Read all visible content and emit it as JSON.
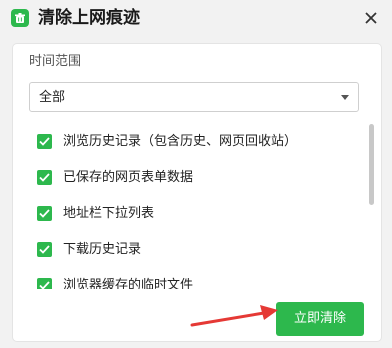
{
  "dialog": {
    "title": "清除上网痕迹",
    "icon": "app-clean-icon",
    "close_icon": "close-icon"
  },
  "time_range": {
    "label": "时间范围",
    "selected": "全部"
  },
  "options": [
    {
      "label": "浏览历史记录（包含历史、网页回收站）",
      "checked": true
    },
    {
      "label": "已保存的网页表单数据",
      "checked": true
    },
    {
      "label": "地址栏下拉列表",
      "checked": true
    },
    {
      "label": "下载历史记录",
      "checked": true
    },
    {
      "label": "浏览器缓存的临时文件",
      "checked": true
    }
  ],
  "actions": {
    "clear_label": "立即清除"
  },
  "colors": {
    "accent": "#2db84d",
    "annotation_arrow": "#e53935"
  }
}
